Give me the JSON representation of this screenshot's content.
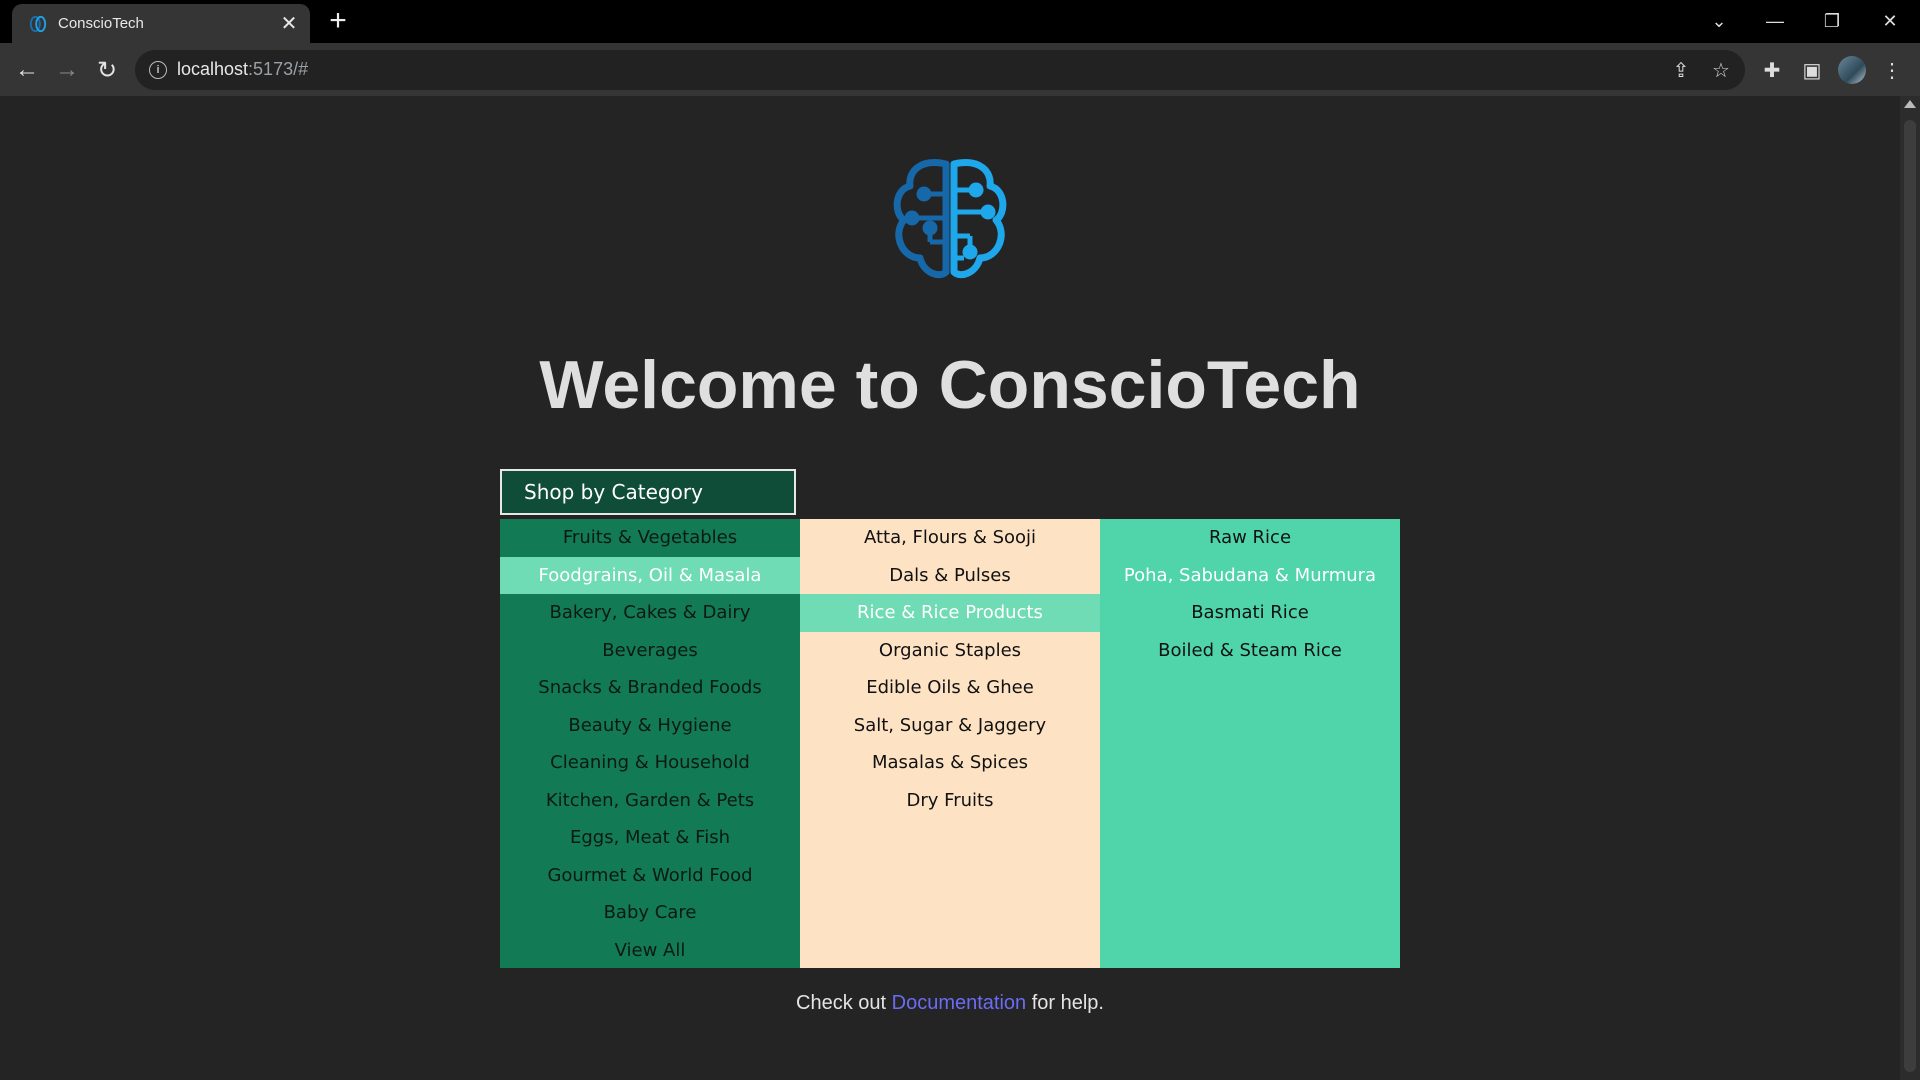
{
  "browser": {
    "tab_title": "ConscioTech",
    "url_host": "localhost",
    "url_rest": ":5173/#"
  },
  "page": {
    "heading": "Welcome to ConscioTech",
    "shop_button": "Shop by Category",
    "footer_prefix": "Check out ",
    "footer_link": "Documentation",
    "footer_suffix": " for help."
  },
  "categories": [
    "Fruits & Vegetables",
    "Foodgrains, Oil & Masala",
    "Bakery, Cakes & Dairy",
    "Beverages",
    "Snacks & Branded Foods",
    "Beauty & Hygiene",
    "Cleaning & Household",
    "Kitchen, Garden & Pets",
    "Eggs, Meat & Fish",
    "Gourmet & World Food",
    "Baby Care",
    "View All"
  ],
  "subcategories": [
    "Atta, Flours & Sooji",
    "Dals & Pulses",
    "Rice & Rice Products",
    "Organic Staples",
    "Edible Oils & Ghee",
    "Salt, Sugar & Jaggery",
    "Masalas & Spices",
    "Dry Fruits"
  ],
  "products": [
    "Raw Rice",
    "Poha, Sabudana & Murmura",
    "Basmati Rice",
    "Boiled & Steam Rice"
  ],
  "colors": {
    "page_bg": "#242424",
    "shop_button_bg": "#0f4d38",
    "column1_bg": "#127a55",
    "column2_bg": "#fde2c4",
    "column3_bg": "#4fd5a9",
    "active_item_bg": "#6fdcb6",
    "link": "#6b6cf5"
  }
}
